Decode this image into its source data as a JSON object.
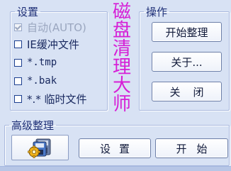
{
  "settings": {
    "title": "设置",
    "options": [
      {
        "label": "自动(AUTO)",
        "checked": true,
        "disabled": true
      },
      {
        "label": "IE缓冲文件",
        "checked": false,
        "disabled": false
      },
      {
        "label": "*.tmp",
        "checked": false,
        "disabled": false
      },
      {
        "label": "*.bak",
        "checked": false,
        "disabled": false
      },
      {
        "label": "*.* 临时文件",
        "checked": false,
        "disabled": false
      }
    ]
  },
  "app_title_chars": [
    "磁",
    "盘",
    "清",
    "理",
    "大",
    "师"
  ],
  "operations": {
    "title": "操作",
    "start_clean": "开始整理",
    "about": "关于...",
    "close": "关闭"
  },
  "advanced": {
    "title": "高级整理",
    "icon": "disk-tools-icon",
    "settings_label": "设置",
    "start_label": "开始"
  },
  "colors": {
    "background": "#d8e2f4",
    "title_accent": "#d61fd6",
    "text": "#1a2a60"
  }
}
